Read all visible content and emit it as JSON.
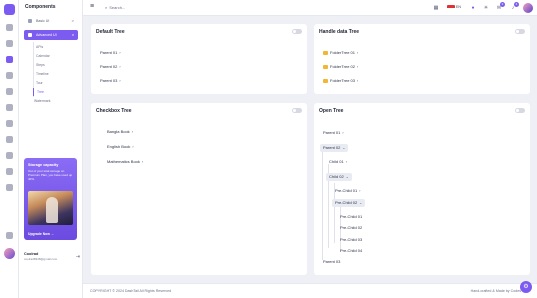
{
  "sidebar": {
    "title": "Components",
    "items": [
      {
        "label": "Basic UI",
        "chevron": ">"
      },
      {
        "label": "Advanced UI",
        "chevron": "v"
      }
    ],
    "subitems": [
      "APIs",
      "Calendar",
      "Steps",
      "Timeline",
      "Tour",
      "Tree",
      "Watermark"
    ],
    "active_subitem": "Tree",
    "promo": {
      "heading": "Storage capacity",
      "text": "Out of your total storage on Premium Plan, you have used up 40%.",
      "button": "Upgrade Now  →"
    },
    "user": {
      "name": "Coolrad",
      "email": "coolrad8348@gmail.com"
    }
  },
  "topbar": {
    "search_placeholder": "Search...",
    "language": "EN",
    "notifications": "4",
    "messages": "3"
  },
  "cards": {
    "default_tree": {
      "title": "Default Tree",
      "nodes": [
        "Parent 01",
        "Parent 02",
        "Parent 03"
      ]
    },
    "handle_data_tree": {
      "title": "Handle data Tree",
      "nodes": [
        "FolderTree 01",
        "FolderTree 02",
        "FolderTree 03"
      ]
    },
    "checkbox_tree": {
      "title": "Checkbox Tree",
      "nodes": [
        "Bangla Book",
        "English Book",
        "Mathematics Book"
      ]
    },
    "open_tree": {
      "title": "Open Tree",
      "parent01": "Parent 01",
      "parent02": "Parent 02",
      "child01": "Child 01",
      "child02": "Child 02",
      "prechild01": "Pre-Child 01",
      "prechild02": "Pre-Child 02",
      "leaves": [
        "Pre-Child 01",
        "Pre-Child 02",
        "Pre-Child 03",
        "Pre-Child 04"
      ],
      "parent03": "Parent 03"
    }
  },
  "footer": {
    "copyright": "COPYRIGHT © 2024 DashTail All Rights Reserved",
    "credit": "Hand-crafted & Made by Codes"
  },
  "colors": {
    "accent": "#7c5cf0",
    "folder": "#f2b632"
  }
}
